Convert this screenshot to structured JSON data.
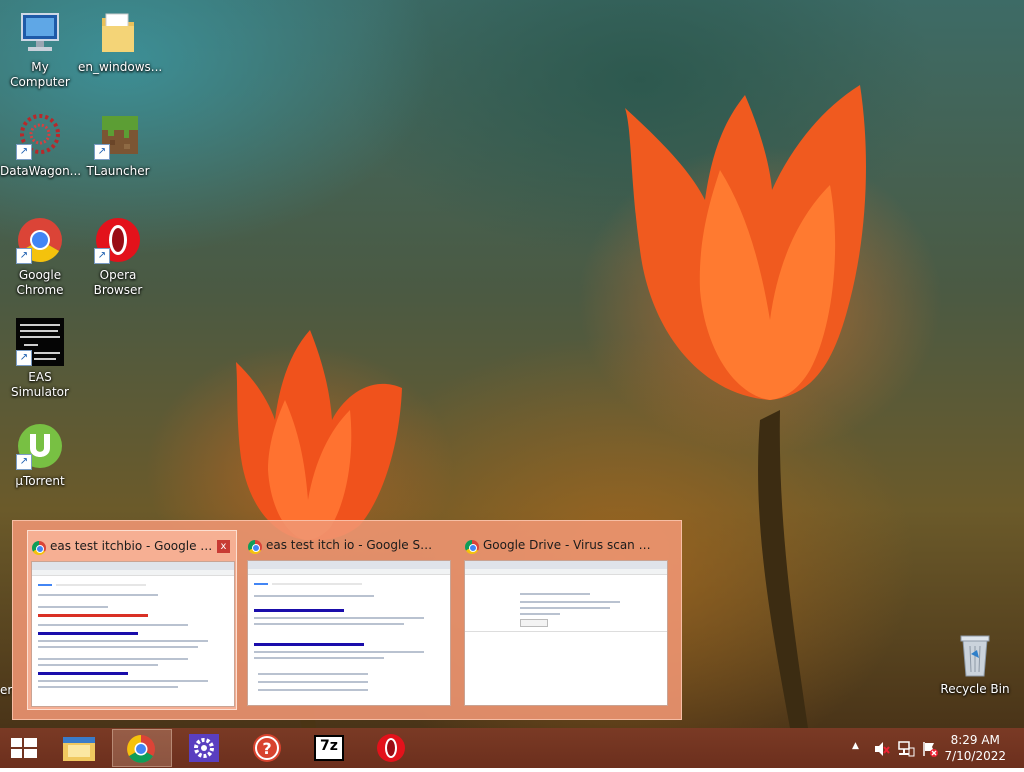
{
  "desktop": {
    "icons": [
      {
        "label": "My Computer"
      },
      {
        "label": "en_windows..."
      },
      {
        "label": "DataWagon..."
      },
      {
        "label": "TLauncher"
      },
      {
        "label": "Google Chrome"
      },
      {
        "label": "Opera Browser"
      },
      {
        "label": "EAS Simulator"
      },
      {
        "label": "µTorrent"
      },
      {
        "label": "Recycle Bin"
      }
    ],
    "partial_label": "er"
  },
  "thumbnails": [
    {
      "title": "eas test itchbio - Google Sea...",
      "close": "x"
    },
    {
      "title": "eas test itch io - Google Search ..."
    },
    {
      "title": "Google Drive - Virus scan warni..."
    }
  ],
  "taskbar": {
    "seven_zip_label": "7z",
    "clock": {
      "time": "8:29 AM",
      "date": "7/10/2022"
    },
    "tray_chevron": "▲"
  },
  "colors": {
    "taskbar": "#6c2f1d",
    "thumbnail_panel": "#f0966f"
  }
}
